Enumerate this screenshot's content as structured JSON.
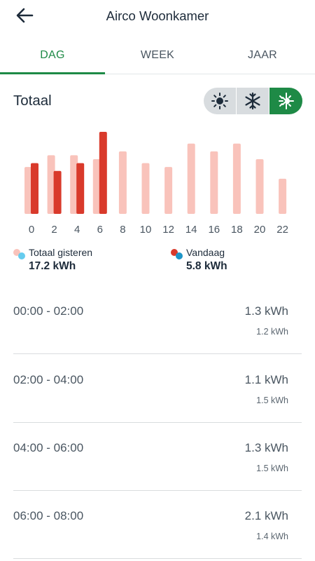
{
  "header": {
    "title": "Airco Woonkamer",
    "back_icon": "arrow-left-icon"
  },
  "tabs": [
    {
      "label": "DAG",
      "active": true
    },
    {
      "label": "WEEK",
      "active": false
    },
    {
      "label": "JAAR",
      "active": false
    }
  ],
  "section": {
    "title": "Totaal"
  },
  "mode_toggle": [
    {
      "icon": "sun-icon",
      "active": false
    },
    {
      "icon": "snowflake-icon",
      "active": false
    },
    {
      "icon": "heat-cool-icon",
      "active": true
    }
  ],
  "colors": {
    "accent": "#1e8a46",
    "yesterday_bar": "#f9c3bb",
    "today_bar": "#d93a2b",
    "today_dot": "#1e96c8",
    "yesterday_dot": "#66ccee"
  },
  "chart_data": {
    "type": "bar",
    "categories": [
      "0",
      "2",
      "4",
      "6",
      "8",
      "10",
      "12",
      "14",
      "16",
      "18",
      "20",
      "22"
    ],
    "series": [
      {
        "name": "Totaal gisteren",
        "values": [
          1.2,
          1.5,
          1.5,
          1.4,
          1.6,
          1.3,
          1.2,
          1.8,
          1.6,
          1.8,
          1.4,
          0.9
        ]
      },
      {
        "name": "Vandaag",
        "values": [
          1.3,
          1.1,
          1.3,
          2.1,
          null,
          null,
          null,
          null,
          null,
          null,
          null,
          null
        ]
      }
    ],
    "ylim": [
      0,
      2.1
    ]
  },
  "legend": [
    {
      "label": "Totaal gisteren",
      "value": "17.2 kWh"
    },
    {
      "label": "Vandaag",
      "value": "5.8 kWh"
    }
  ],
  "rows": [
    {
      "time": "00:00 - 02:00",
      "today": "1.3 kWh",
      "yesterday": "1.2 kWh"
    },
    {
      "time": "02:00 - 04:00",
      "today": "1.1 kWh",
      "yesterday": "1.5 kWh"
    },
    {
      "time": "04:00 - 06:00",
      "today": "1.3 kWh",
      "yesterday": "1.5 kWh"
    },
    {
      "time": "06:00 - 08:00",
      "today": "2.1 kWh",
      "yesterday": "1.4 kWh"
    }
  ]
}
